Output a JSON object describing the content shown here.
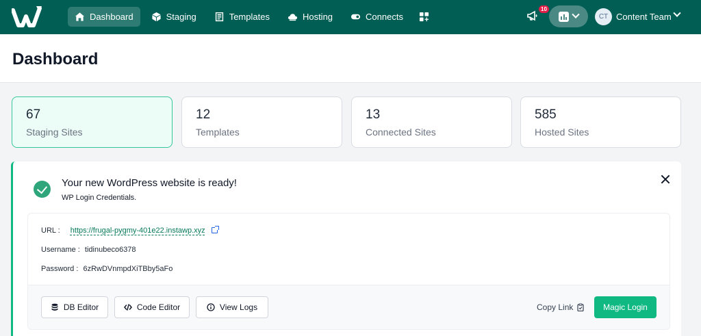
{
  "nav": {
    "items": [
      {
        "label": "Dashboard",
        "icon": "home-icon",
        "active": true
      },
      {
        "label": "Staging",
        "icon": "cube-icon"
      },
      {
        "label": "Templates",
        "icon": "template-icon"
      },
      {
        "label": "Hosting",
        "icon": "cloud-icon"
      },
      {
        "label": "Connects",
        "icon": "toggle-icon"
      }
    ],
    "notification_count": "10",
    "user_initials": "CT",
    "user_name": "Content Team"
  },
  "page": {
    "title": "Dashboard"
  },
  "stats": [
    {
      "value": "67",
      "label": "Staging Sites"
    },
    {
      "value": "12",
      "label": "Templates"
    },
    {
      "value": "13",
      "label": "Connected Sites"
    },
    {
      "value": "585",
      "label": "Hosted Sites"
    }
  ],
  "notice": {
    "title": "Your new WordPress website is ready!",
    "subtitle": "WP Login Credentials.",
    "url_label": "URL :",
    "url": "https://frugal-pygmy-401e22.instawp.xyz",
    "username_label": "Username :",
    "username": "tidinubeco6378",
    "password_label": "Password :",
    "password": "6zRwDVnmpdXiTBby5aFo",
    "buttons": {
      "db_editor": "DB Editor",
      "code_editor": "Code Editor",
      "view_logs": "View Logs",
      "copy_link": "Copy Link",
      "magic_login": "Magic Login"
    }
  },
  "colors": {
    "brand": "#005e54",
    "accent": "#10b981"
  }
}
